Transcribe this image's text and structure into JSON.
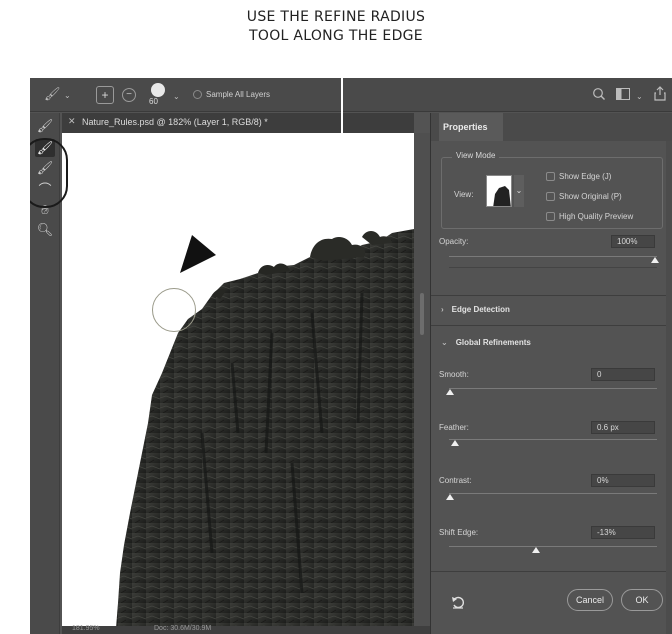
{
  "caption": {
    "line1": "USE THE REFINE RADIUS",
    "line2": "TOOL ALONG THE EDGE"
  },
  "options_bar": {
    "brush_size": "60",
    "sample_all_layers_label": "Sample All Layers",
    "icons": [
      "refine-edge-brush-icon",
      "add-to-selection-icon",
      "subtract-from-selection-icon",
      "search-icon",
      "workspace-icon",
      "share-icon"
    ]
  },
  "toolbar": {
    "tools": [
      "quick-selection-icon",
      "refine-edge-brush-icon",
      "brush-icon",
      "lasso-icon",
      "hand-icon",
      "zoom-icon"
    ],
    "active": "refine-edge-brush-icon"
  },
  "document": {
    "tab_title": "Nature_Rules.psd @ 182% (Layer 1, RGB/8) *"
  },
  "status": {
    "zoom": "181.95%",
    "doc_size": "Doc: 30.6M/30.9M"
  },
  "properties": {
    "tab_label": "Properties",
    "view_mode_legend": "View Mode",
    "view_label": "View:",
    "show_edge": "Show Edge (J)",
    "show_original": "Show Original (P)",
    "high_quality_preview": "High Quality Preview",
    "opacity_label": "Opacity:",
    "opacity_value": "100%",
    "edge_detection": "Edge Detection",
    "global_refinements": "Global Refinements",
    "smooth_label": "Smooth:",
    "smooth_value": "0",
    "feather_label": "Feather:",
    "feather_value": "0.6 px",
    "contrast_label": "Contrast:",
    "contrast_value": "0%",
    "shift_edge_label": "Shift Edge:",
    "shift_edge_value": "-13%",
    "cancel_label": "Cancel",
    "ok_label": "OK"
  }
}
